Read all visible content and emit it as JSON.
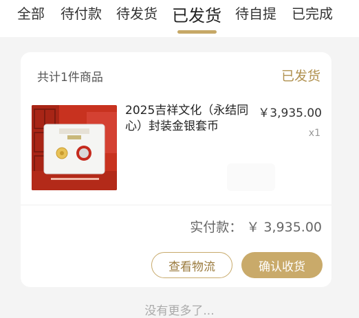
{
  "tabs": [
    {
      "label": "全部"
    },
    {
      "label": "待付款"
    },
    {
      "label": "待发货"
    },
    {
      "label": "已发货"
    },
    {
      "label": "待自提"
    },
    {
      "label": "已完成"
    }
  ],
  "active_tab": "已发货",
  "order": {
    "count_text": "共计1件商品",
    "status": "已发货",
    "product_name": "2025吉祥文化（永结同心）封装金银套币",
    "price": "￥3,935.00",
    "quantity": "x1",
    "paid_label": "实付款：",
    "paid_amount": "￥ 3,935.00",
    "buttons": {
      "logistics": "查看物流",
      "confirm": "确认收货"
    }
  },
  "footer_text": "没有更多了...",
  "colors": {
    "accent_gold": "#c6a867",
    "card_bg": "#ffffff",
    "page_bg": "#f4f4f4"
  }
}
